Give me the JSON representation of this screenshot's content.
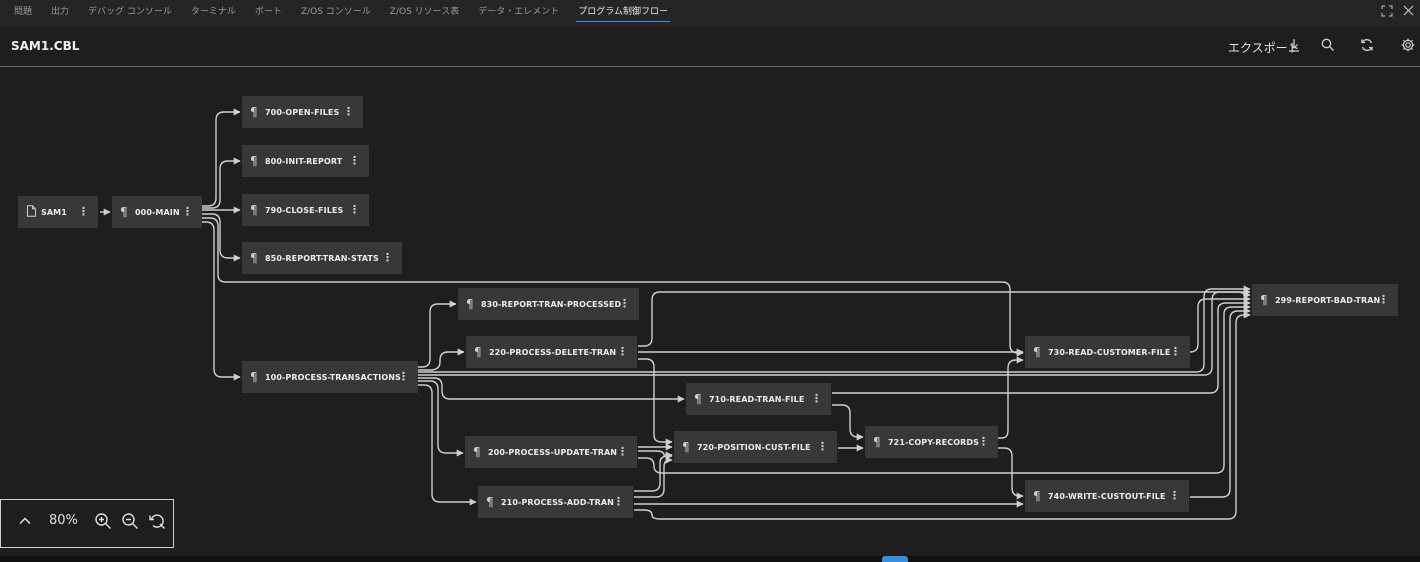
{
  "tabs": [
    {
      "label": "問題"
    },
    {
      "label": "出力"
    },
    {
      "label": "デバッグ コンソール"
    },
    {
      "label": "ターミナル"
    },
    {
      "label": "ポート"
    },
    {
      "label": "Z/OS コンソール"
    },
    {
      "label": "Z/OS リソース表"
    },
    {
      "label": "データ・エレメント"
    },
    {
      "label": "プログラム制御フロー",
      "active": true
    }
  ],
  "header": {
    "title": "SAM1.CBL",
    "export_label": "エクスポート"
  },
  "nodes": [
    {
      "id": "sam1",
      "label": "SAM1",
      "icon": "file-icon"
    },
    {
      "id": "main",
      "label": "000-MAIN",
      "icon": "paragraph-icon"
    },
    {
      "id": "n700",
      "label": "700-OPEN-FILES",
      "icon": "paragraph-icon"
    },
    {
      "id": "n800",
      "label": "800-INIT-REPORT",
      "icon": "paragraph-icon"
    },
    {
      "id": "n790",
      "label": "790-CLOSE-FILES",
      "icon": "paragraph-icon"
    },
    {
      "id": "n850",
      "label": "850-REPORT-TRAN-STATS",
      "icon": "paragraph-icon"
    },
    {
      "id": "n830",
      "label": "830-REPORT-TRAN-PROCESSED",
      "icon": "paragraph-icon"
    },
    {
      "id": "n220",
      "label": "220-PROCESS-DELETE-TRAN",
      "icon": "paragraph-icon"
    },
    {
      "id": "n100",
      "label": "100-PROCESS-TRANSACTIONS",
      "icon": "paragraph-icon"
    },
    {
      "id": "n710",
      "label": "710-READ-TRAN-FILE",
      "icon": "paragraph-icon"
    },
    {
      "id": "n200",
      "label": "200-PROCESS-UPDATE-TRAN",
      "icon": "paragraph-icon"
    },
    {
      "id": "n720",
      "label": "720-POSITION-CUST-FILE",
      "icon": "paragraph-icon"
    },
    {
      "id": "n721",
      "label": "721-COPY-RECORDS",
      "icon": "paragraph-icon"
    },
    {
      "id": "n210",
      "label": "210-PROCESS-ADD-TRAN",
      "icon": "paragraph-icon"
    },
    {
      "id": "n730",
      "label": "730-READ-CUSTOMER-FILE",
      "icon": "paragraph-icon"
    },
    {
      "id": "n740",
      "label": "740-WRITE-CUSTOUT-FILE",
      "icon": "paragraph-icon"
    },
    {
      "id": "n299",
      "label": "299-REPORT-BAD-TRAN",
      "icon": "paragraph-icon"
    }
  ],
  "zoom": {
    "level": "80%"
  },
  "colors": {
    "background": "#1e1e1e",
    "node": "#383838",
    "edge": "#cfcfcf",
    "active_tab_underline": "#3794ff"
  }
}
